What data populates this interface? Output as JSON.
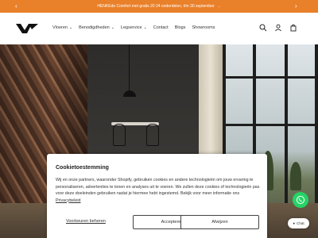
{
  "announcement": {
    "text": "HENKEdo Comfort met gratis 20 24 onderdelen, t/m 30 september",
    "arrow": "→",
    "prev_icon": "chevron-left-icon",
    "next_icon": "chevron-right-icon",
    "bg_color": "#e9802a"
  },
  "header": {
    "logo": "brand-logo",
    "nav": [
      {
        "label": "Vloeren",
        "has_dropdown": true
      },
      {
        "label": "Benodigdheden",
        "has_dropdown": true
      },
      {
        "label": "Legservice",
        "has_dropdown": true
      },
      {
        "label": "Contact",
        "has_dropdown": false
      },
      {
        "label": "Blogs",
        "has_dropdown": false
      },
      {
        "label": "Showrooms",
        "has_dropdown": false
      }
    ],
    "icons": [
      "search-icon",
      "account-icon",
      "cart-icon"
    ]
  },
  "cookie_banner": {
    "title": "Cookietoestemming",
    "body": "Wij en onze partners, waaronder Shopify, gebruiken cookies en andere technologieën om jouw ervaring te personaliseren, advertenties te tonen en analyses uit te voeren. We zullen deze cookies of technologieën pas voor deze doeleinden gebruiken nadat je hiermee hebt ingestemd. Bekijk voor meer informatie ons",
    "privacy_link": "Privacybeleid",
    "preferences_label": "Voorkeuren beheren",
    "accept_label": "Accepteren",
    "reject_label": "Afwijzen"
  },
  "widgets": {
    "whatsapp_icon": "whatsapp-icon",
    "chat_label": "Chat"
  }
}
